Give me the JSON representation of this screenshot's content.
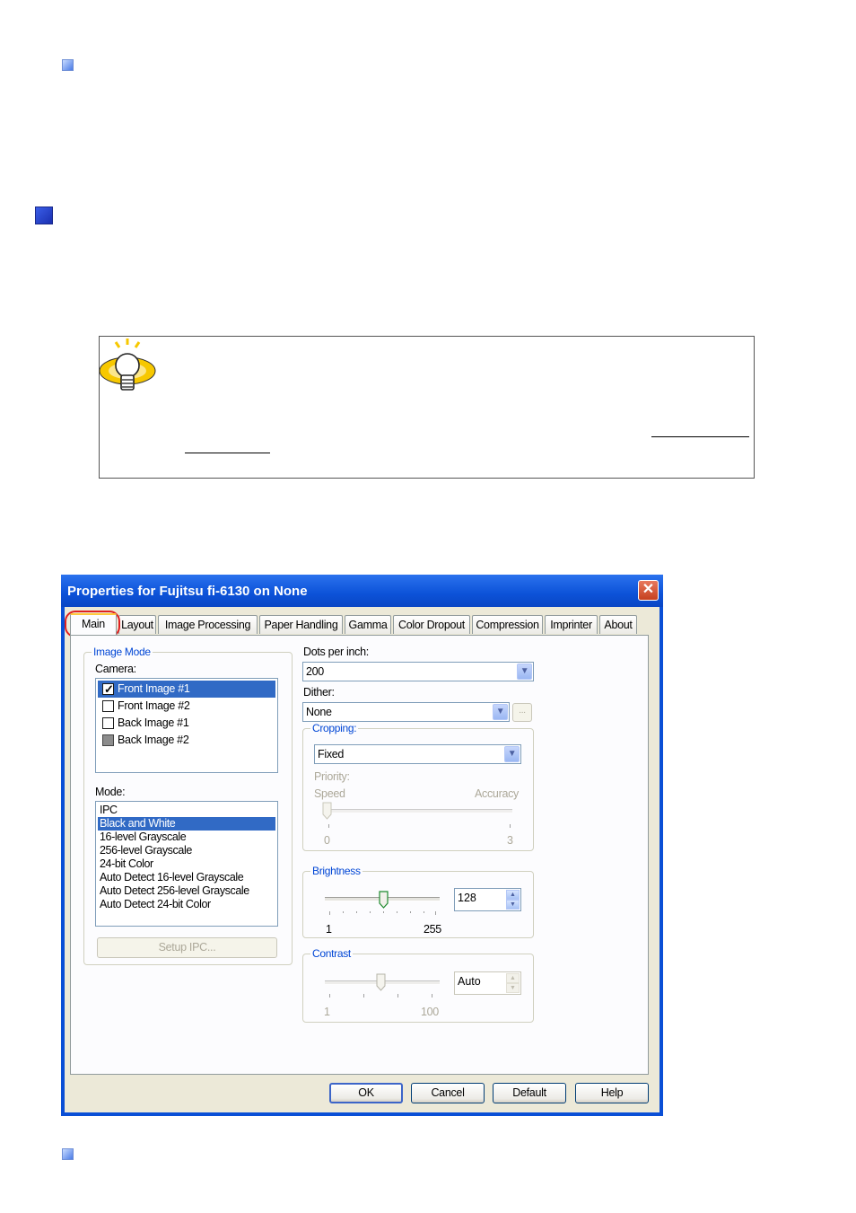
{
  "dialog": {
    "title": "Properties for Fujitsu fi-6130 on None",
    "close_glyph": "✕",
    "tabs": [
      "Main",
      "Layout",
      "Image Processing",
      "Paper Handling",
      "Gamma",
      "Color Dropout",
      "Compression",
      "Imprinter",
      "About"
    ],
    "active_tab": "Main",
    "image_mode": {
      "group_title": "Image Mode",
      "camera_label": "Camera:",
      "cameras": [
        {
          "label": "Front Image #1",
          "checked": true,
          "selected": true
        },
        {
          "label": "Front Image #2",
          "checked": false
        },
        {
          "label": "Back Image #1",
          "checked": false
        },
        {
          "label": "Back Image #2",
          "checked": false,
          "grey": true
        }
      ],
      "mode_label": "Mode:",
      "modes": [
        "IPC",
        "Black and White",
        "16-level Grayscale",
        "256-level Grayscale",
        "24-bit Color",
        "Auto Detect 16-level Grayscale",
        "Auto Detect 256-level Grayscale",
        "Auto Detect 24-bit Color"
      ],
      "selected_mode": "Black and White",
      "setup_ipc_label": "Setup IPC..."
    },
    "dpi": {
      "label": "Dots per inch:",
      "value": "200"
    },
    "dither": {
      "label": "Dither:",
      "value": "None",
      "more_label": "..."
    },
    "cropping": {
      "group_title": "Cropping:",
      "value": "Fixed",
      "priority_label": "Priority:",
      "speed_label": "Speed",
      "accuracy_label": "Accuracy",
      "min": "0",
      "max": "3"
    },
    "brightness": {
      "group_title": "Brightness",
      "value": "128",
      "min": "1",
      "max": "255",
      "level": 0.5
    },
    "contrast": {
      "group_title": "Contrast",
      "value": "Auto",
      "min": "1",
      "max": "100",
      "level": 0.5
    },
    "buttons": {
      "ok": "OK",
      "cancel": "Cancel",
      "default": "Default",
      "help": "Help"
    },
    "spin_up": "▲",
    "spin_down": "▼",
    "combo_arrow": "▼"
  },
  "colors": {
    "title_blue": "#0a4fd6",
    "selection": "#316ac5",
    "highlight_circle": "#e02020"
  }
}
